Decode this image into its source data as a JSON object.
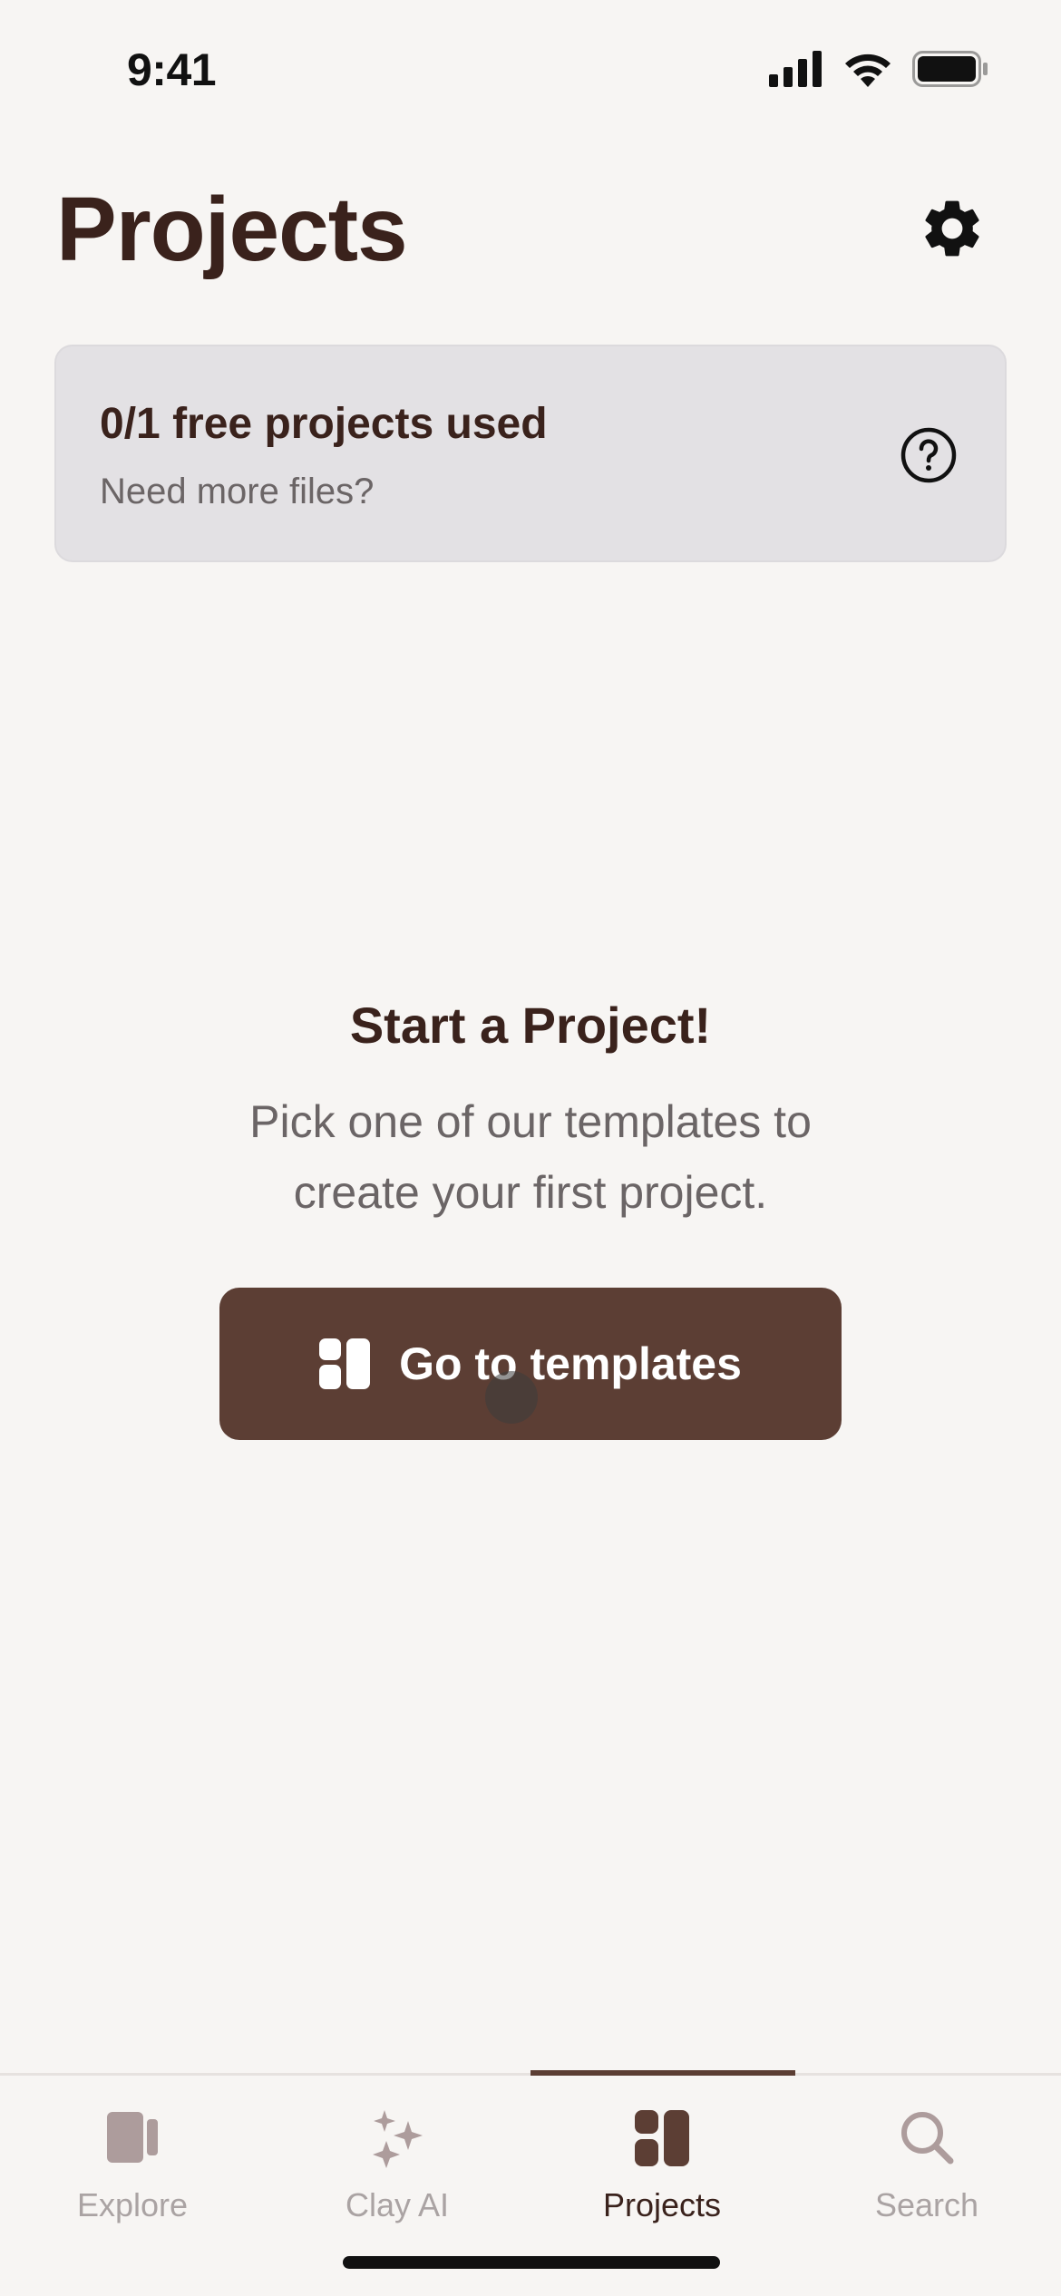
{
  "status_bar": {
    "time": "9:41"
  },
  "header": {
    "title": "Projects"
  },
  "usage_card": {
    "title": "0/1 free projects used",
    "subtitle": "Need more files?"
  },
  "empty_state": {
    "title": "Start a Project!",
    "description": "Pick one of our templates to create your first project.",
    "button_label": "Go to templates"
  },
  "tabs": [
    {
      "label": "Explore",
      "icon": "explore-icon",
      "active": false
    },
    {
      "label": "Clay AI",
      "icon": "sparkle-icon",
      "active": false
    },
    {
      "label": "Projects",
      "icon": "projects-icon",
      "active": true
    },
    {
      "label": "Search",
      "icon": "search-icon",
      "active": false
    }
  ],
  "colors": {
    "background": "#f7f5f3",
    "text_primary": "#3a221c",
    "accent": "#5c3e34",
    "card_background": "#e3e1e4",
    "tab_inactive": "#aaa3a3"
  }
}
